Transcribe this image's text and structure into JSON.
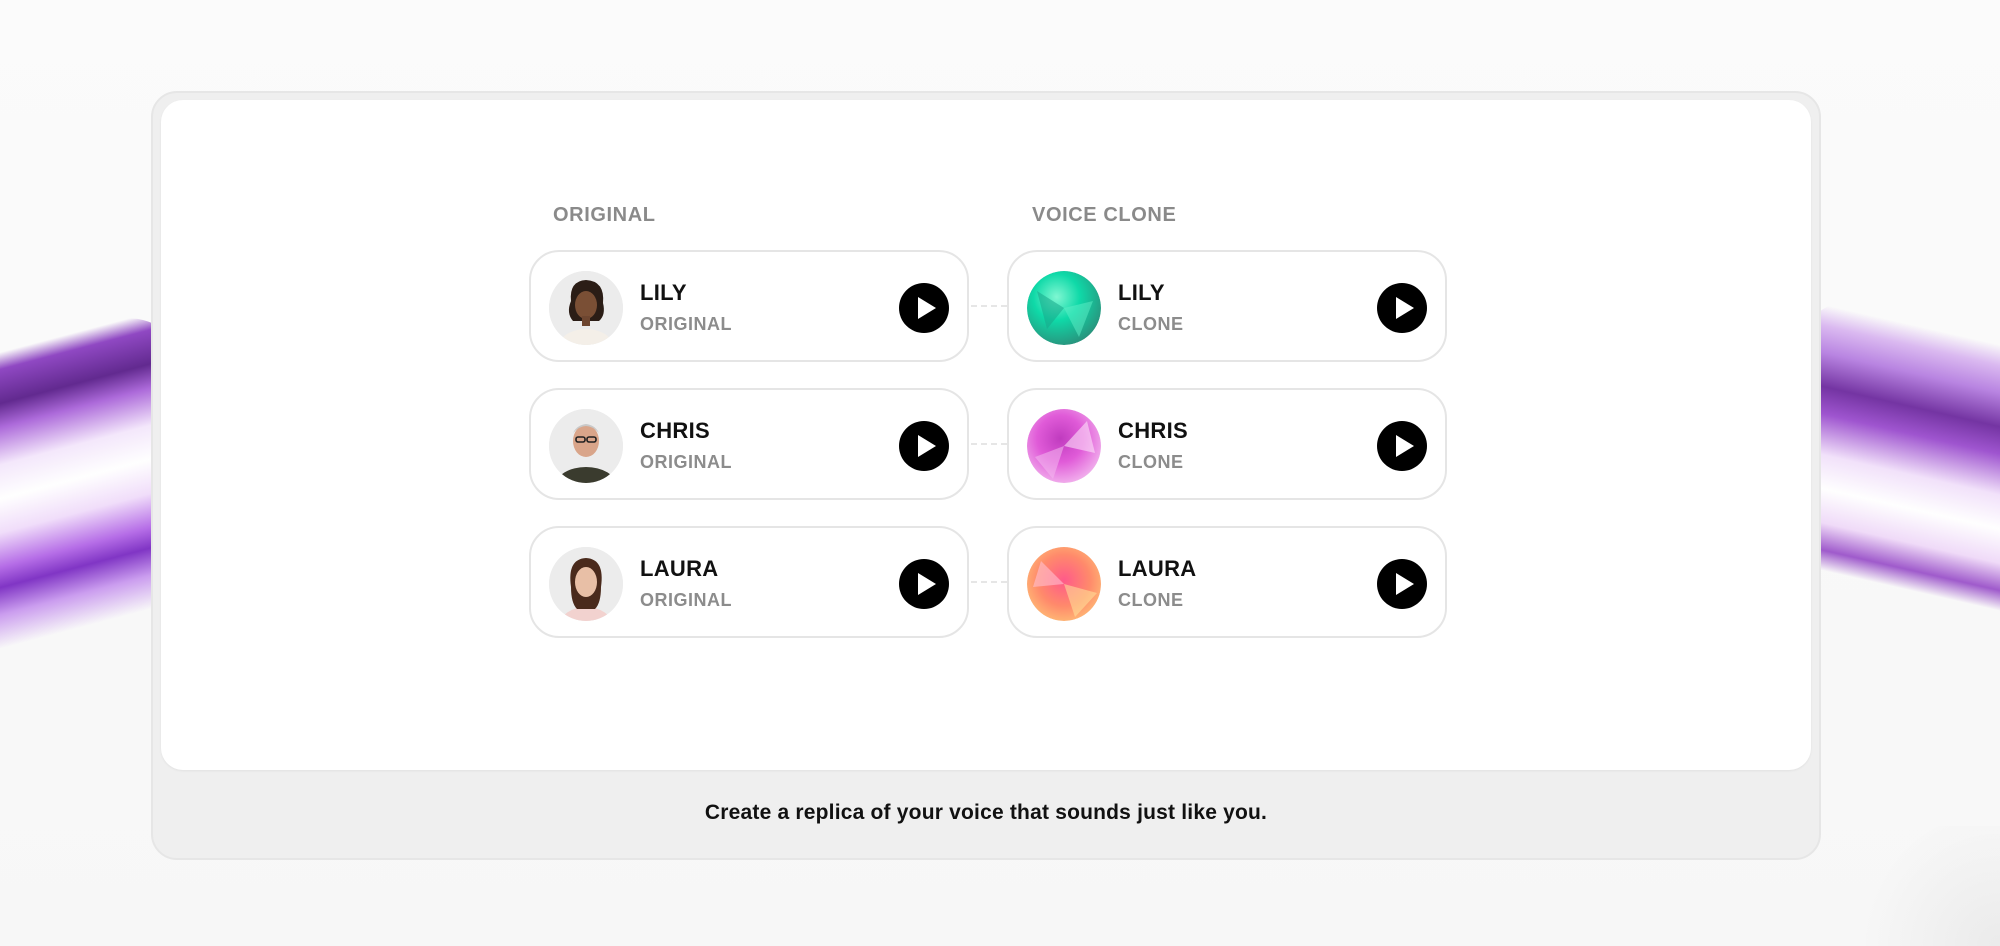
{
  "columns": {
    "original_header": "ORIGINAL",
    "clone_header": "VOICE CLONE"
  },
  "originals": [
    {
      "name": "LILY",
      "label": "ORIGINAL",
      "avatar": "lily-photo"
    },
    {
      "name": "CHRIS",
      "label": "ORIGINAL",
      "avatar": "chris-photo"
    },
    {
      "name": "LAURA",
      "label": "ORIGINAL",
      "avatar": "laura-photo"
    }
  ],
  "clones": [
    {
      "name": "LILY",
      "label": "CLONE",
      "orb_colors": [
        "#0fd9a8",
        "#2a8f7a"
      ]
    },
    {
      "name": "CHRIS",
      "label": "CLONE",
      "orb_colors": [
        "#e05bd8",
        "#f6c6f2"
      ]
    },
    {
      "name": "LAURA",
      "label": "CLONE",
      "orb_colors": [
        "#ff6b7a",
        "#ffd27a"
      ]
    }
  ],
  "play_icon": "play-icon",
  "caption": "Create a replica of your voice that sounds just like you.",
  "colors": {
    "accent_purple": "#7a2bc2",
    "play_button": "#000000"
  }
}
